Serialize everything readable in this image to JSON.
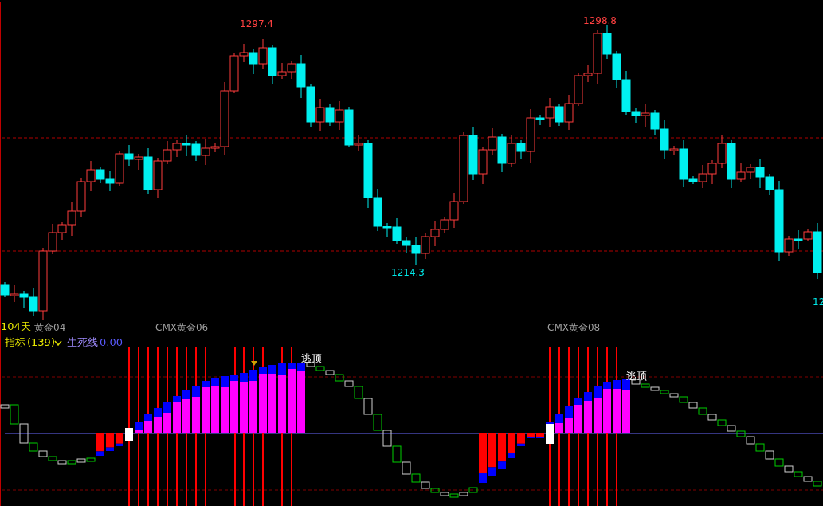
{
  "main_chart": {
    "high_labels": [
      "1297.4",
      "1298.8"
    ],
    "low_labels": [
      "1214.3",
      "12"
    ],
    "period_label": "104天",
    "contract_labels": [
      "黄金04",
      "CMX黄金06",
      "CMX黄金08"
    ]
  },
  "indicator_panel": {
    "name": "指标",
    "param": "(139)",
    "line_name": "生死线",
    "line_value": "0.00",
    "signals": [
      "逃顶",
      "逃顶"
    ]
  }
}
